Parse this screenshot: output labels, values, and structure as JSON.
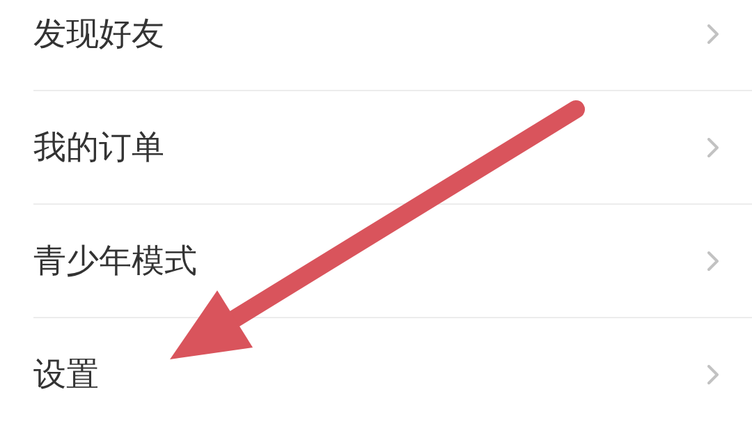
{
  "menu": {
    "items": [
      {
        "label": "发现好友"
      },
      {
        "label": "我的订单"
      },
      {
        "label": "青少年模式"
      },
      {
        "label": "设置"
      }
    ]
  }
}
